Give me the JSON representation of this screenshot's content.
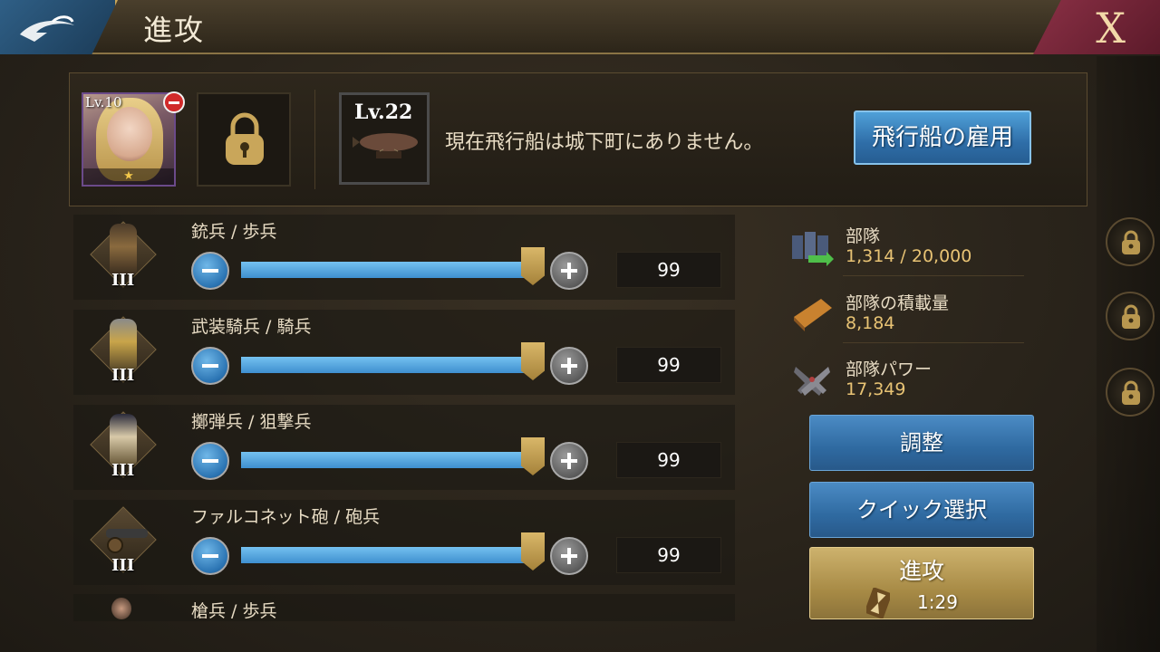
{
  "header": {
    "title": "進攻",
    "back_icon": "back-arrow-icon",
    "close_label": "X"
  },
  "formation": {
    "hero": {
      "level": "Lv.10",
      "star": "★"
    },
    "airship": {
      "level": "Lv.22",
      "message": "現在飛行船は城下町にありません。",
      "hire_label": "飛行船の雇用"
    }
  },
  "units": [
    {
      "name": "銃兵 / 歩兵",
      "tier": "III",
      "quantity": "99",
      "slider_fraction": 1.0
    },
    {
      "name": "武装騎兵 / 騎兵",
      "tier": "III",
      "quantity": "99",
      "slider_fraction": 1.0
    },
    {
      "name": "擲弾兵 / 狙撃兵",
      "tier": "III",
      "quantity": "99",
      "slider_fraction": 1.0
    },
    {
      "name": "ファルコネット砲 / 砲兵",
      "tier": "III",
      "quantity": "99",
      "slider_fraction": 1.0
    },
    {
      "name": "槍兵 / 歩兵"
    }
  ],
  "stats": {
    "troops": {
      "label": "部隊",
      "value": "1,314 / 20,000"
    },
    "load": {
      "label": "部隊の積載量",
      "value": "8,184"
    },
    "power": {
      "label": "部隊パワー",
      "value": "17,349"
    }
  },
  "actions": {
    "adjust": "調整",
    "quick_select": "クイック選択",
    "attack": "進攻",
    "march_time": "1:29"
  },
  "colors": {
    "accent_blue": "#3e8fcf",
    "gold": "#e8c374",
    "remove_red": "#d12a2a"
  }
}
